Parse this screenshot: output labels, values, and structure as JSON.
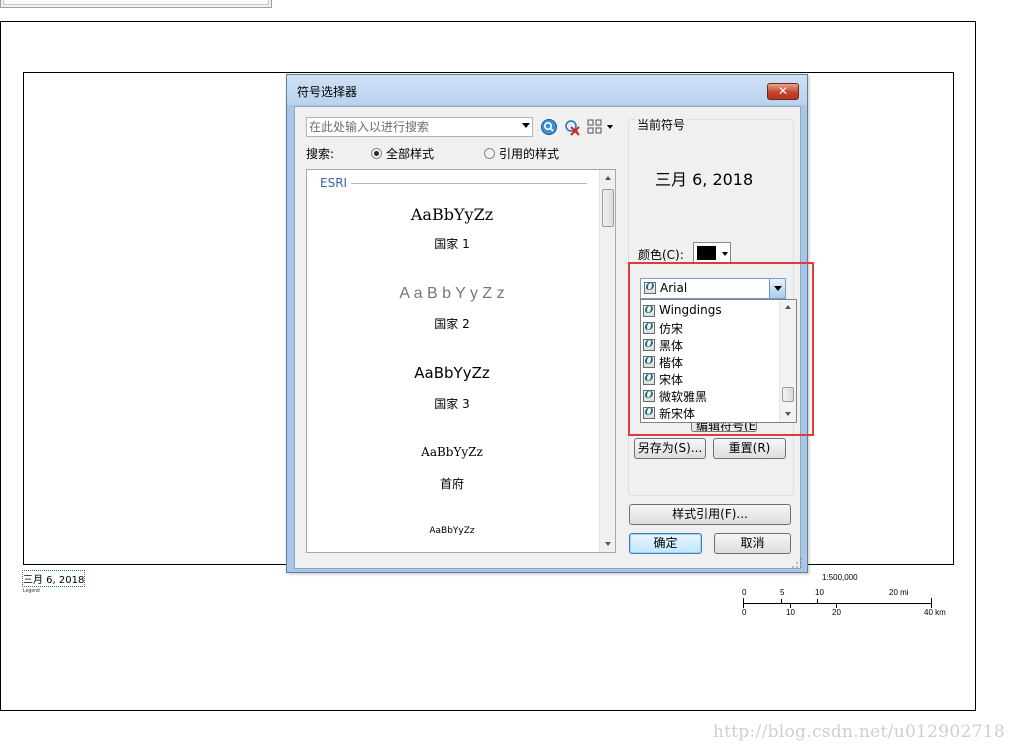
{
  "layout_page": {
    "date_text": "三月 6, 2018",
    "tiny_caption": "Legend",
    "scale_text": "1:500,000",
    "scale_miles": [
      "0",
      "5",
      "10",
      "20 mi"
    ],
    "scale_km": [
      "0",
      "10",
      "20",
      "40 km"
    ]
  },
  "watermark": "http://blog.csdn.net/u012902718",
  "dialog": {
    "title": "符号选择器",
    "close_label": "✕",
    "search": {
      "placeholder": "在此处输入以进行搜索",
      "label": "搜索:",
      "option_all": "全部样式",
      "option_ref": "引用的样式",
      "option_all_selected": true
    },
    "symbol_list": {
      "group": "ESRI",
      "items": [
        {
          "sample": "AaBbYyZz",
          "name": "国家 1"
        },
        {
          "sample": "A a B b Y y Z z",
          "name": "国家 2"
        },
        {
          "sample": "AaBbYyZz",
          "name": "国家 3"
        },
        {
          "sample": "AaBbYyZz",
          "name": "首府"
        },
        {
          "sample": "AaBbYyZz",
          "name": ""
        }
      ]
    },
    "current": {
      "label": "当前符号",
      "preview": "三月 6, 2018",
      "color_label": "颜色(C):",
      "color": "#000000",
      "font_selected": "Arial",
      "font_options": [
        "Wingdings",
        "仿宋",
        "黑体",
        "楷体",
        "宋体",
        "微软雅黑",
        "新宋体"
      ],
      "edit_symbol_label": "编辑符号(E)...",
      "save_as_label": "另存为(S)...",
      "reset_label": "重置(R)"
    },
    "style_refs_label": "样式引用(F)...",
    "ok_label": "确定",
    "cancel_label": "取消"
  },
  "colors": {
    "highlight": "#e03a3a",
    "group_header": "#3a62a8",
    "titlebar": "#b9d2ee"
  }
}
